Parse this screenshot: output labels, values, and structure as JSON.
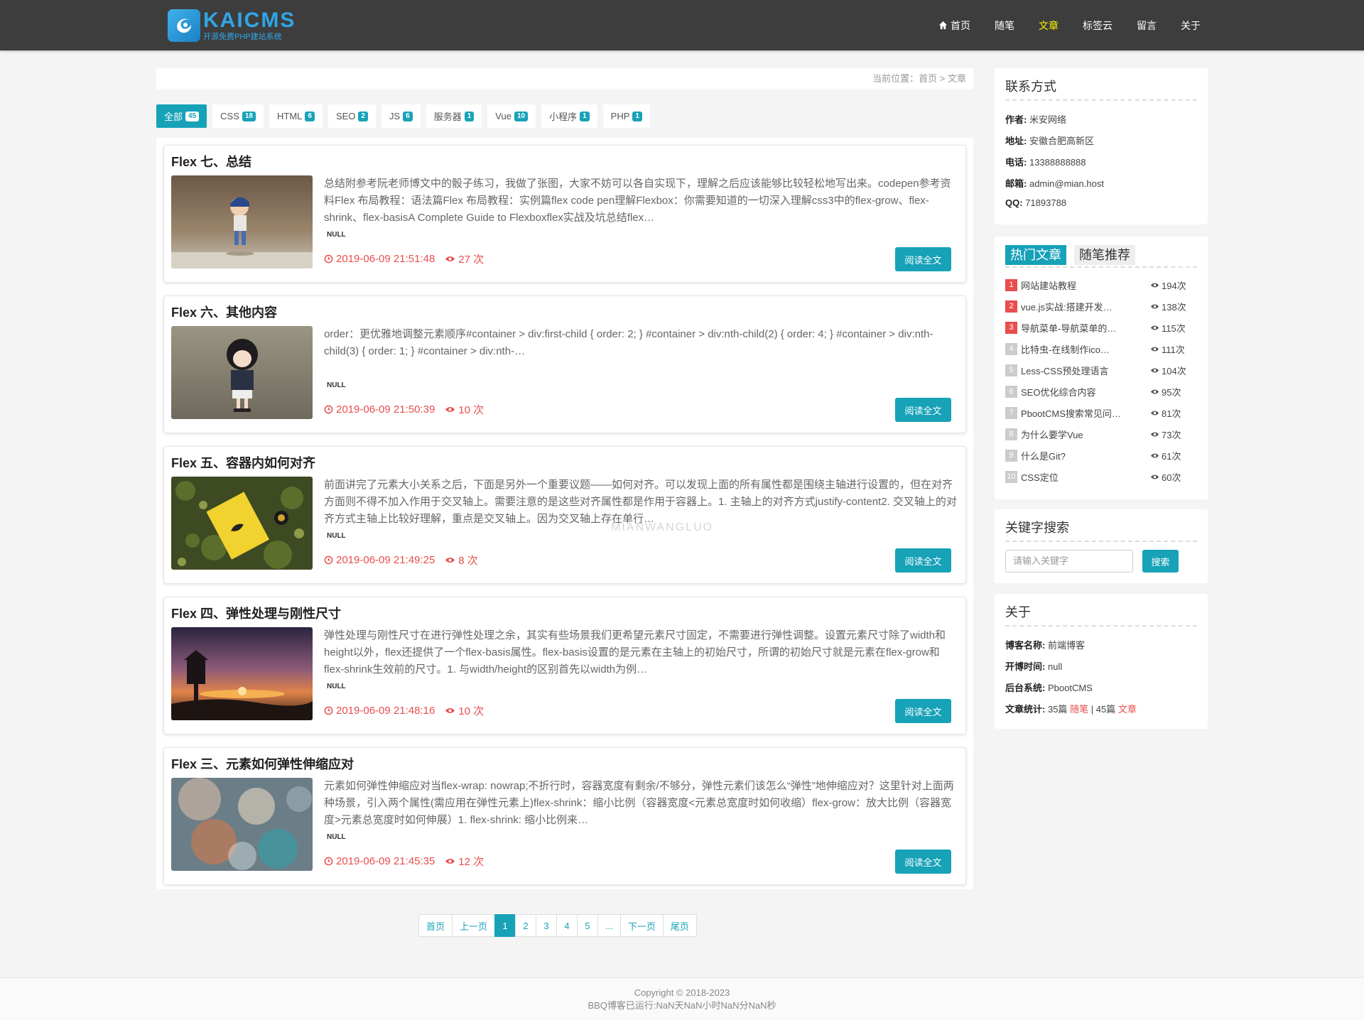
{
  "header": {
    "logo_name": "KAICMS",
    "logo_sub": "开源免费PHP建站系统",
    "nav": [
      {
        "label": "首页",
        "active": false
      },
      {
        "label": "随笔",
        "active": false
      },
      {
        "label": "文章",
        "active": true
      },
      {
        "label": "标签云",
        "active": false
      },
      {
        "label": "留言",
        "active": false
      },
      {
        "label": "关于",
        "active": false
      }
    ]
  },
  "breadcrumb": {
    "prefix": "当前位置：",
    "home": "首页",
    "sep": ">",
    "current": "文章"
  },
  "tabs": [
    {
      "label": "全部",
      "count": "45",
      "active": true
    },
    {
      "label": "CSS",
      "count": "18"
    },
    {
      "label": "HTML",
      "count": "6"
    },
    {
      "label": "SEO",
      "count": "2"
    },
    {
      "label": "JS",
      "count": "6"
    },
    {
      "label": "服务器",
      "count": "1"
    },
    {
      "label": "Vue",
      "count": "10"
    },
    {
      "label": "小程序",
      "count": "1"
    },
    {
      "label": "PHP",
      "count": "1"
    }
  ],
  "articles": [
    {
      "title": "Flex 七、总结",
      "excerpt": "总结附参考阮老师博文中的骰子练习，我做了张图，大家不妨可以各自实现下，理解之后应该能够比较轻松地写出来。codepen参考资料Flex 布局教程：语法篇Flex 布局教程：实例篇flex code pen理解Flexbox：你需要知道的一切深入理解css3中的flex-grow、flex-shrink、flex-basisA Complete Guide to Flexboxflex实战及坑总结flex…",
      "tag": "NULL",
      "date": "2019-06-09 21:51:48",
      "views": "27 次",
      "button": "阅读全文"
    },
    {
      "title": "Flex 六、其他内容",
      "excerpt": "order：更优雅地调整元素顺序#container > div:first-child {  order: 2; } #container > div:nth-child(2) {  order: 4; } #container > div:nth-child(3) {  order: 1; } #container > div:nth-…",
      "tag": "NULL",
      "date": "2019-06-09 21:50:39",
      "views": "10 次",
      "button": "阅读全文"
    },
    {
      "title": "Flex 五、容器内如何对齐",
      "excerpt": "前面讲完了元素大小关系之后，下面是另外一个重要议题——如何对齐。可以发现上面的所有属性都是围绕主轴进行设置的，但在对齐方面则不得不加入作用于交叉轴上。需要注意的是这些对齐属性都是作用于容器上。1. 主轴上的对齐方式justify-content2. 交叉轴上的对齐方式主轴上比较好理解，重点是交叉轴上。因为交叉轴上存在单行…",
      "tag": "NULL",
      "date": "2019-06-09 21:49:25",
      "views": "8 次",
      "button": "阅读全文"
    },
    {
      "title": "Flex 四、弹性处理与刚性尺寸",
      "excerpt": "弹性处理与刚性尺寸在进行弹性处理之余，其实有些场景我们更希望元素尺寸固定，不需要进行弹性调整。设置元素尺寸除了width和height以外，flex还提供了一个flex-basis属性。flex-basis设置的是元素在主轴上的初始尺寸，所谓的初始尺寸就是元素在flex-grow和flex-shrink生效前的尺寸。1. 与width/height的区别首先以width为例…",
      "tag": "NULL",
      "date": "2019-06-09 21:48:16",
      "views": "10 次",
      "button": "阅读全文"
    },
    {
      "title": "Flex 三、元素如何弹性伸缩应对",
      "excerpt": "元素如何弹性伸缩应对当flex-wrap: nowrap;不折行时，容器宽度有剩余/不够分，弹性元素们该怎么“弹性”地伸缩应对？这里针对上面两种场景，引入两个属性(需应用在弹性元素上)flex-shrink：缩小比例（容器宽度<元素总宽度时如何收缩）flex-grow：放大比例（容器宽度>元素总宽度时如何伸展）1. flex-shrink: 缩小比例来…",
      "tag": "NULL",
      "date": "2019-06-09 21:45:35",
      "views": "12 次",
      "button": "阅读全文"
    }
  ],
  "pagination": [
    "首页",
    "上一页",
    "1",
    "2",
    "3",
    "4",
    "5",
    "...",
    "下一页",
    "尾页"
  ],
  "pagination_current": "1",
  "contact": {
    "title": "联系方式",
    "rows": [
      {
        "label": "作者:",
        "value": "米安网络"
      },
      {
        "label": "地址:",
        "value": "安徽合肥高新区"
      },
      {
        "label": "电话:",
        "value": "13388888888"
      },
      {
        "label": "邮箱:",
        "value": "admin@mian.host"
      },
      {
        "label": "QQ:",
        "value": "71893788"
      }
    ]
  },
  "hot": {
    "tab_active": "热门文章",
    "tab_other": "随笔推荐",
    "items": [
      {
        "rank": "1",
        "name": "网站建站教程",
        "views": "194次"
      },
      {
        "rank": "2",
        "name": "vue.js实战:搭建开发…",
        "views": "138次"
      },
      {
        "rank": "3",
        "name": "导航菜单-导航菜单的…",
        "views": "115次"
      },
      {
        "rank": "4",
        "name": "比特虫-在线制作ico…",
        "views": "111次"
      },
      {
        "rank": "5",
        "name": "Less-CSS预处理语言",
        "views": "104次"
      },
      {
        "rank": "6",
        "name": "SEO优化综合内容",
        "views": "95次"
      },
      {
        "rank": "7",
        "name": "PbootCMS搜索常见问…",
        "views": "81次"
      },
      {
        "rank": "8",
        "name": "为什么要学Vue",
        "views": "73次"
      },
      {
        "rank": "9",
        "name": "什么是Git?",
        "views": "61次"
      },
      {
        "rank": "10",
        "name": "CSS定位",
        "views": "60次"
      }
    ]
  },
  "search": {
    "title": "关键字搜索",
    "placeholder": "请输入关键字",
    "button": "搜索"
  },
  "about": {
    "title": "关于",
    "blog_name_label": "博客名称:",
    "blog_name": "前端博客",
    "start_label": "开博时间:",
    "start": "null",
    "system_label": "后台系统:",
    "system": "PbootCMS",
    "stats_label": "文章统计:",
    "essays_count": "35篇",
    "essays_link": "随笔",
    "divider": "|",
    "articles_count": "45篇",
    "articles_link": "文章"
  },
  "footer": {
    "copyright": "Copyright © 2018-2023",
    "runtime": "BBQ博客已运行:NaN天NaN小时NaN分NaN秒"
  },
  "watermark": "MIANWANGLUO",
  "colors": {
    "accent": "#17a2b8",
    "header_bg": "#3d3d3d",
    "nav_active": "#fff200",
    "meta_red": "#e94d4d"
  }
}
